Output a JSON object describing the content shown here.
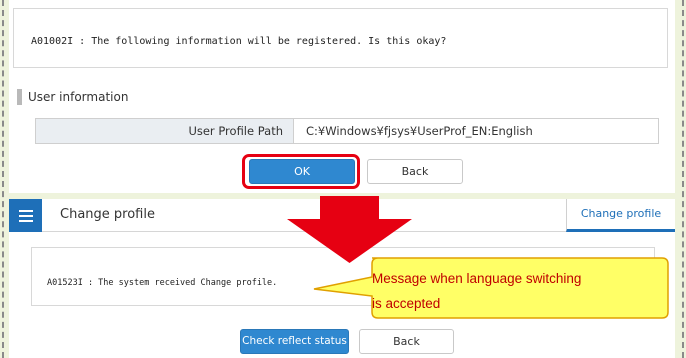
{
  "confirm_dialog": {
    "message": "A01002I : The following information will be registered. Is this okay?",
    "section_title": "User information",
    "table": {
      "label": "User Profile Path",
      "value": "C:¥Windows¥fjsys¥UserProf_EN:English"
    },
    "ok_label": "OK",
    "back_label": "Back"
  },
  "change_profile_screen": {
    "title": "Change profile",
    "tab_label": "Change profile",
    "message": "A01523I : The system received Change profile.",
    "check_label": "Check reflect status",
    "back_label": "Back"
  },
  "annotation": {
    "callout_line1": "Message when language switching",
    "callout_line2": "is accepted"
  },
  "colors": {
    "accent_blue": "#2f88d0",
    "header_blue": "#1e6fb8",
    "highlight_red": "#e60012",
    "callout_fill": "#ffff66",
    "callout_text": "#c00000",
    "background": "#eef3dc"
  },
  "icons": {
    "menu": "hamburger-menu-icon",
    "arrow": "down-arrow-icon"
  }
}
